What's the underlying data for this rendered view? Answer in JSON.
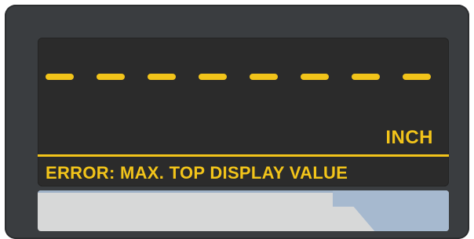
{
  "display": {
    "top_readout": "- - - - - - - -",
    "unit": "INCH",
    "status_message": "ERROR: MAX. TOP DISPLAY VALUE"
  },
  "colors": {
    "bezel": "#3a3d40",
    "screen": "#2b2b2b",
    "segment_yellow": "#f2c41a",
    "softkey_gray": "#d7d8d8",
    "softkey_blue": "#a6b9cf"
  }
}
